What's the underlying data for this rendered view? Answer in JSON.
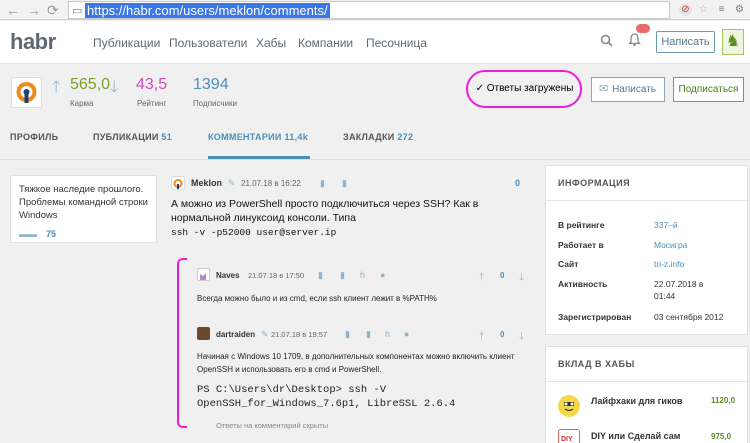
{
  "browser": {
    "url": "https://habr.com/users/meklon/comments/"
  },
  "header": {
    "logo": "habr",
    "nav": [
      "Публикации",
      "Пользователи",
      "Хабы",
      "Компании",
      "Песочница"
    ],
    "write_button": "Написать"
  },
  "profile": {
    "karma_value": "565,0",
    "karma_label": "Карма",
    "rating_value": "43,5",
    "rating_label": "Рейтинг",
    "subscribers_value": "1394",
    "subscribers_label": "Подписчики",
    "answers_loaded": "✓ Ответы загружены",
    "message_button": "Написать",
    "subscribe_button": "Подписаться",
    "tabs": [
      {
        "label": "ПРОФИЛЬ",
        "count": ""
      },
      {
        "label": "ПУБЛИКАЦИИ",
        "count": "51"
      },
      {
        "label": "КОММЕНТАРИИ",
        "count": "11,4k"
      },
      {
        "label": "ЗАКЛАДКИ",
        "count": "272"
      }
    ]
  },
  "post_card": {
    "title": "Тяжкое наследие прошлого. Проблемы командной строки Windows",
    "comments_count": "75"
  },
  "comment": {
    "author": "Meklon",
    "time": "21.07.18 в 16:22",
    "score": "0",
    "text": "А можно из PowerShell просто подключиться через SSH? Как в нормальной линуксоид консоли. Типа",
    "code": "ssh -v -p52000 user@server.ip"
  },
  "replies": [
    {
      "author": "Naves",
      "time": "21.07.18 в 17:50",
      "score": "0",
      "text": "Всегда можно было и из cmd, если ssh клиент лежит в %PATH%"
    },
    {
      "author": "dartraiden",
      "time": "21.07.18 в 19:57",
      "score": "0",
      "text": "Начиная с Windows 10 1709, в дополнительных компонентах можно включить клиент OpenSSH и использовать его в cmd и PowerShell.",
      "code_line1": "PS C:\\Users\\dr\\Desktop> ssh -V",
      "code_line2": "OpenSSH_for_Windows_7.6p1, LibreSSL 2.6.4"
    }
  ],
  "replies_closed": "Ответы на комментарий скрыты",
  "info": {
    "title": "ИНФОРМАЦИЯ",
    "rows": [
      {
        "label": "В рейтинге",
        "value": "337–й"
      },
      {
        "label": "Работает в",
        "value": "Mосигра"
      },
      {
        "label": "Сайт",
        "value": "tri-z.info"
      },
      {
        "label": "Активность",
        "value": "22.07.2018 в 01:44"
      },
      {
        "label": "Зарегистрирован",
        "value": "03 сентября 2012"
      }
    ]
  },
  "hubs": {
    "title": "ВКЛАД В ХАБЫ",
    "items": [
      {
        "name": "Лайфхаки для гиков",
        "value": "1120,0"
      },
      {
        "name": "DIY или Сделай сам",
        "value": "975,0"
      }
    ]
  }
}
